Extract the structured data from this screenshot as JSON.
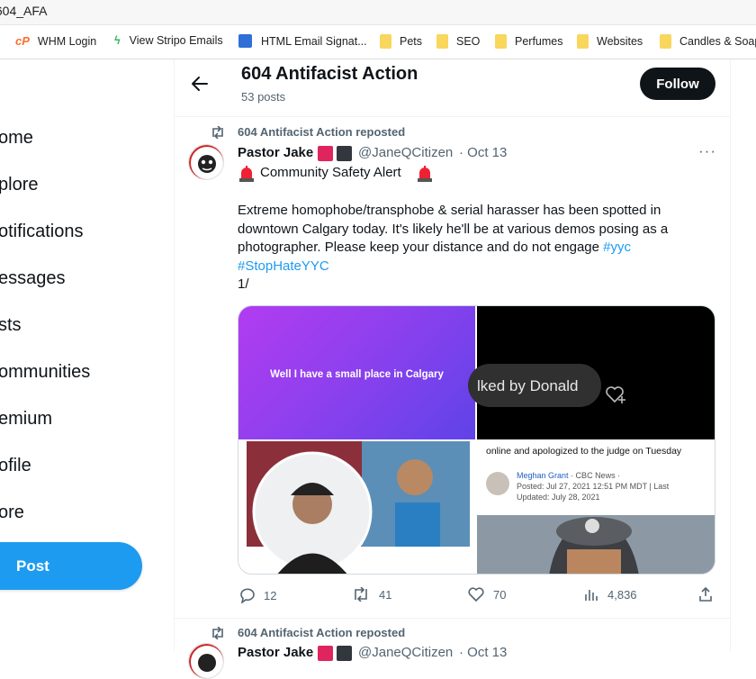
{
  "browser": {
    "url_fragment": "/604_AFA",
    "bookmarks": [
      {
        "label": "WHM Login",
        "icon": "cpanel-icon"
      },
      {
        "label": "View Stripo Emails",
        "icon": "stripo-icon"
      },
      {
        "label": "HTML Email Signat...",
        "icon": "signature-icon"
      },
      {
        "label": "Pets",
        "icon": "folder-icon"
      },
      {
        "label": "SEO",
        "icon": "folder-icon"
      },
      {
        "label": "Perfumes",
        "icon": "folder-icon"
      },
      {
        "label": "Websites",
        "icon": "folder-icon"
      },
      {
        "label": "Candles & Soap",
        "icon": "folder-icon"
      }
    ]
  },
  "nav": {
    "items": [
      "ome",
      "plore",
      "otifications",
      "essages",
      "sts",
      "ommunities",
      "emium",
      "ofile",
      "ore"
    ],
    "post_label": "Post"
  },
  "profile_header": {
    "name": "604 Antifacist Action",
    "posts_count": "53 posts",
    "follow_label": "Follow"
  },
  "tweet": {
    "repost_text": "604 Antifacist Action reposted",
    "author_name": "Pastor Jake",
    "handle": "@JaneQCitizen",
    "date": "· Oct 13",
    "headline": "Community Safety Alert",
    "body_lines": [
      "Extreme homophobe/transphobe & serial harasser has been spotted in",
      "downtown Calgary today. It's likely he'll be at various demos posing as a",
      "photographer. Please keep your distance and do not engage"
    ],
    "hashtag_yyc": "#yyc",
    "hashtag_stophate": "#StopHateYYC",
    "thread_marker": "1/",
    "media": {
      "tile1_caption": "Well I have a small place in Calgary",
      "tile2_caption": "lked by Donald",
      "tile4_headline": "online and apologized to the judge on Tuesday",
      "tile4_byline": "Meghan Grant",
      "tile4_source": "· CBC News ·",
      "tile4_posted": "Posted: Jul 27, 2021 12:51 PM MDT | Last",
      "tile4_updated": "Updated: July 28, 2021"
    },
    "actions": {
      "replies": "12",
      "reposts": "41",
      "likes": "70",
      "views": "4,836"
    }
  },
  "next_tweet": {
    "repost_text": "604 Antifacist Action reposted",
    "author_name": "Pastor Jake",
    "handle": "@JaneQCitizen",
    "date": "· Oct 13"
  },
  "colors": {
    "accent": "#1d9bf0",
    "text": "#0f1419",
    "muted": "#536471",
    "alert_red": "#e0245e"
  }
}
